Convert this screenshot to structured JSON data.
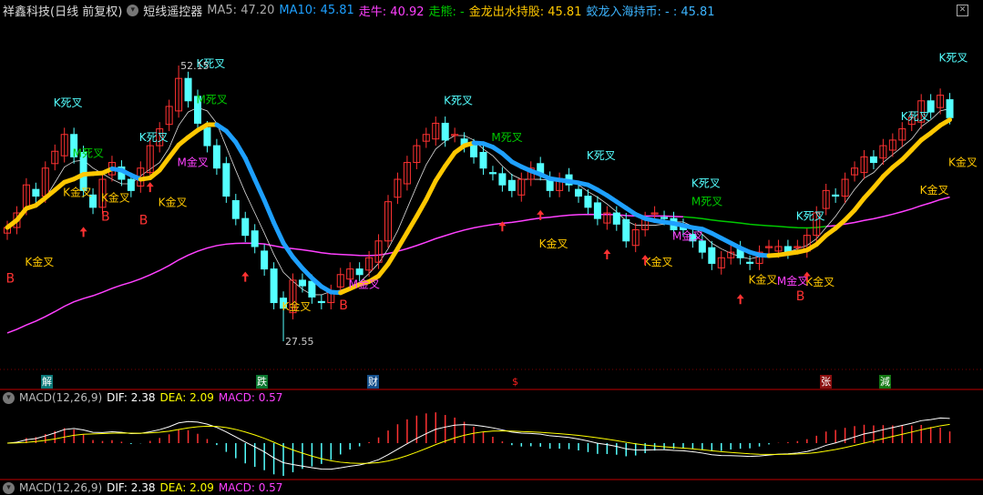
{
  "header": {
    "title": "祥鑫科技(日线 前复权)",
    "indicator_name": "短线遥控器",
    "ma5": "MA5: 47.20",
    "ma10": "MA10: 45.81",
    "zouniu": "走牛: 40.92",
    "zouxiong": "走熊: -",
    "jinlong": "金龙出水持股: 45.81",
    "jiaolong": "蛟龙入海持币: - : 45.81"
  },
  "colors": {
    "up": "#ff3232",
    "down": "#54ffff",
    "yellow": "#ffc800",
    "blue": "#1ea0ff",
    "magenta": "#ff40ff",
    "green": "#00c800"
  },
  "price_labels": {
    "high": "52.15",
    "low": "27.55"
  },
  "chart_data": {
    "type": "candlestick",
    "closes": [
      37.7,
      39,
      41.5,
      40.5,
      43,
      44.5,
      46,
      44,
      41,
      39.5,
      42,
      43.5,
      42,
      41,
      43,
      45,
      46.5,
      48.5,
      51,
      49,
      47,
      45,
      43,
      40.5,
      38.5,
      37,
      36,
      34,
      31,
      30.5,
      33,
      32.5,
      31.5,
      31,
      32,
      33.5,
      34,
      33.5,
      35,
      36.5,
      40,
      42,
      43.5,
      45,
      46,
      47,
      45.5,
      46,
      45,
      44,
      43,
      42.5,
      41.5,
      41,
      42,
      43,
      42.5,
      41,
      42,
      41.5,
      40.5,
      39.5,
      38.5,
      39,
      38,
      36.5,
      37.5,
      38.5,
      39,
      38.5,
      37.5,
      37.5,
      36.5,
      35.5,
      34.5,
      35,
      35.5,
      35,
      34.5,
      35.5,
      36,
      36,
      35.5,
      36,
      37,
      39,
      41,
      40.5,
      42,
      43,
      44,
      43.5,
      45,
      45.5,
      46.5,
      47.5,
      49,
      48,
      49.5,
      47.5
    ],
    "high_point": {
      "index": 18,
      "price": 52.15
    },
    "low_point": {
      "index": 29,
      "price": 27.55
    }
  },
  "annotations": [
    {
      "t": "K金叉",
      "i": 3,
      "p": 34.3,
      "c": "yellow"
    },
    {
      "t": "B",
      "i": 1,
      "p": 32.8,
      "c": "up"
    },
    {
      "t": "K死叉",
      "i": 6,
      "p": 48.5,
      "c": "down"
    },
    {
      "t": "M死叉",
      "i": 8,
      "p": 44,
      "c": "green"
    },
    {
      "t": "K金叉",
      "i": 7,
      "p": 40.5,
      "c": "yellow"
    },
    {
      "t": "K金叉",
      "i": 11,
      "p": 40,
      "c": "yellow"
    },
    {
      "t": "B",
      "i": 11,
      "p": 38.3,
      "c": "up"
    },
    {
      "t": "B",
      "i": 15,
      "p": 38,
      "c": "up"
    },
    {
      "t": "K金叉",
      "i": 17,
      "p": 39.6,
      "c": "yellow"
    },
    {
      "t": "K死叉",
      "i": 15,
      "p": 45.4,
      "c": "down"
    },
    {
      "t": "M金叉",
      "i": 19,
      "p": 43.2,
      "c": "magenta"
    },
    {
      "t": "M死叉",
      "i": 21,
      "p": 48.8,
      "c": "green"
    },
    {
      "t": "K死叉",
      "i": 21,
      "p": 52,
      "c": "down"
    },
    {
      "t": "K金叉",
      "i": 30,
      "p": 30.3,
      "c": "yellow"
    },
    {
      "t": "M金叉",
      "i": 37,
      "p": 32.3,
      "c": "magenta"
    },
    {
      "t": "B",
      "i": 36,
      "p": 30.4,
      "c": "up"
    },
    {
      "t": "K死叉",
      "i": 47,
      "p": 48.7,
      "c": "down"
    },
    {
      "t": "M死叉",
      "i": 52,
      "p": 45.4,
      "c": "green"
    },
    {
      "t": "K死叉",
      "i": 62,
      "p": 43.8,
      "c": "down"
    },
    {
      "t": "K金叉",
      "i": 57,
      "p": 35.9,
      "c": "yellow"
    },
    {
      "t": "K死叉",
      "i": 73,
      "p": 41.3,
      "c": "down"
    },
    {
      "t": "M死叉",
      "i": 73,
      "p": 39.7,
      "c": "green"
    },
    {
      "t": "M金叉",
      "i": 71,
      "p": 36.6,
      "c": "magenta"
    },
    {
      "t": "K金叉",
      "i": 68,
      "p": 34.3,
      "c": "yellow"
    },
    {
      "t": "K金叉",
      "i": 79,
      "p": 32.7,
      "c": "yellow"
    },
    {
      "t": "M金叉",
      "i": 82,
      "p": 32.6,
      "c": "magenta"
    },
    {
      "t": "K金叉",
      "i": 85,
      "p": 32.5,
      "c": "yellow"
    },
    {
      "t": "B",
      "i": 84,
      "p": 31.2,
      "c": "up"
    },
    {
      "t": "K死叉",
      "i": 84,
      "p": 38.4,
      "c": "down"
    },
    {
      "t": "K死叉",
      "i": 95,
      "p": 47.3,
      "c": "down"
    },
    {
      "t": "K金叉",
      "i": 97,
      "p": 40.7,
      "c": "yellow"
    },
    {
      "t": "K金叉",
      "i": 100,
      "p": 43.2,
      "c": "yellow"
    },
    {
      "t": "K死叉",
      "i": 99,
      "p": 52.5,
      "c": "down"
    }
  ],
  "up_arrows": [
    8,
    15,
    25,
    52,
    56,
    63,
    67,
    77,
    84
  ],
  "bottom_symbols": [
    {
      "t": "解",
      "bg": "#0a7878",
      "fg": "#fff"
    },
    {
      "t": "跌",
      "bg": "#0a7830",
      "fg": "#fff"
    },
    {
      "t": "财",
      "bg": "#14508c",
      "fg": "#fff"
    },
    {
      "t": "$",
      "bg": "transparent",
      "fg": "#ff2020"
    },
    {
      "t": "张",
      "bg": "#8c1010",
      "fg": "#fff"
    },
    {
      "t": "減",
      "bg": "#147814",
      "fg": "#fff"
    }
  ],
  "macd": {
    "name": "MACD(12,26,9)",
    "dif": "DIF: 2.38",
    "dea": "DEA: 2.09",
    "macd": "MACD: 0.57"
  }
}
